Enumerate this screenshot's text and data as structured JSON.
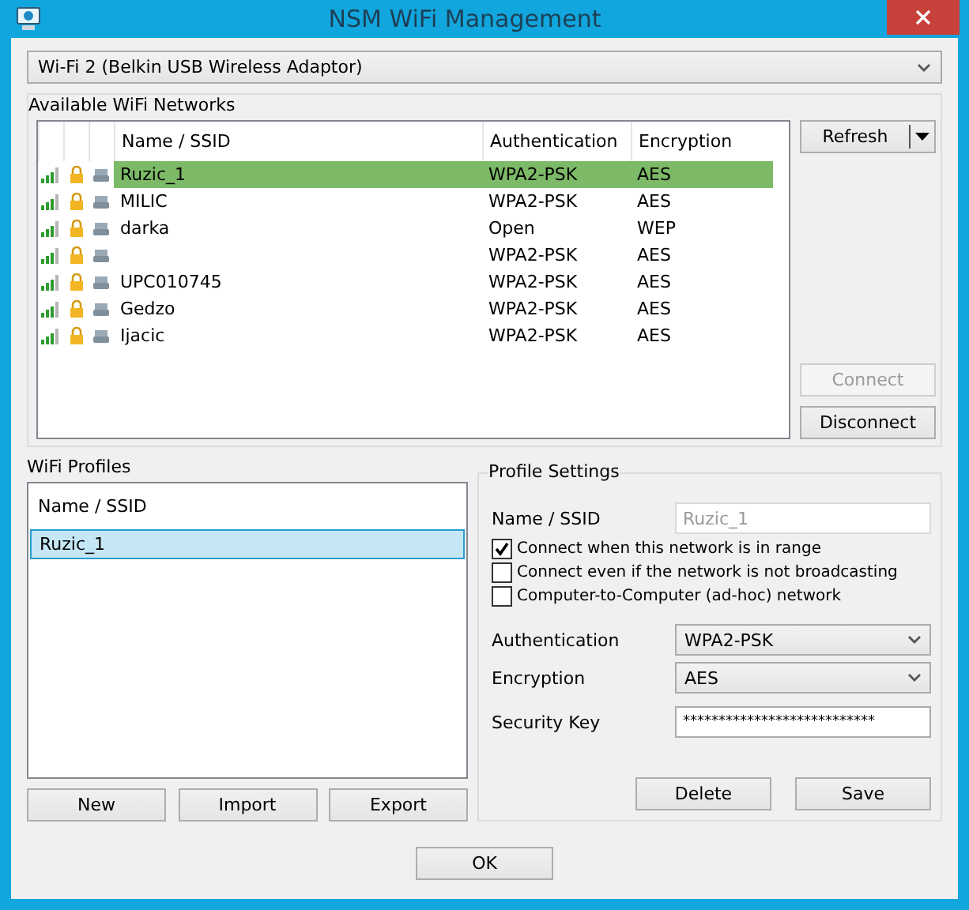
{
  "window": {
    "title": "NSM WiFi Management"
  },
  "adapter": {
    "value": "Wi-Fi 2 (Belkin USB Wireless Adaptor)"
  },
  "networks": {
    "title": "Available WiFi Networks",
    "columns": [
      "Name / SSID",
      "Authentication",
      "Encryption"
    ],
    "rows": [
      {
        "ssid": "Ruzic_1",
        "authentication": "WPA2-PSK",
        "encryption": "AES",
        "selected": true
      },
      {
        "ssid": "MILIC",
        "authentication": "WPA2-PSK",
        "encryption": "AES",
        "selected": false
      },
      {
        "ssid": "darka",
        "authentication": "Open",
        "encryption": "WEP",
        "selected": false
      },
      {
        "ssid": "",
        "authentication": "WPA2-PSK",
        "encryption": "AES",
        "selected": false
      },
      {
        "ssid": "UPC010745",
        "authentication": "WPA2-PSK",
        "encryption": "AES",
        "selected": false
      },
      {
        "ssid": "Gedzo",
        "authentication": "WPA2-PSK",
        "encryption": "AES",
        "selected": false
      },
      {
        "ssid": "Ijacic",
        "authentication": "WPA2-PSK",
        "encryption": "AES",
        "selected": false
      }
    ],
    "refresh": "Refresh",
    "buttons": [
      {
        "label": "Connect",
        "disabled": true
      },
      {
        "label": "Disconnect",
        "disabled": false
      }
    ]
  },
  "profiles": {
    "title": "WiFi Profiles",
    "column": "Name / SSID",
    "items": [
      {
        "name": "Ruzic_1",
        "selected": true
      }
    ],
    "buttons": [
      "New",
      "Import",
      "Export"
    ]
  },
  "settings": {
    "title": "Profile Settings",
    "name": {
      "label": "Name / SSID",
      "value": "Ruzic_1",
      "disabled": true
    },
    "options": [
      {
        "label": "Connect when this network is in range",
        "checked": true
      },
      {
        "label": "Connect even if the network is not broadcasting",
        "checked": false
      },
      {
        "label": "Computer-to-Computer (ad-hoc) network",
        "checked": false
      }
    ],
    "authentication": {
      "label": "Authentication",
      "value": "WPA2-PSK"
    },
    "encryption": {
      "label": "Encryption",
      "value": "AES"
    },
    "key": {
      "label": "Security Key",
      "value": "***************************"
    },
    "buttons": [
      "Delete",
      "Save"
    ]
  },
  "ok": "OK"
}
